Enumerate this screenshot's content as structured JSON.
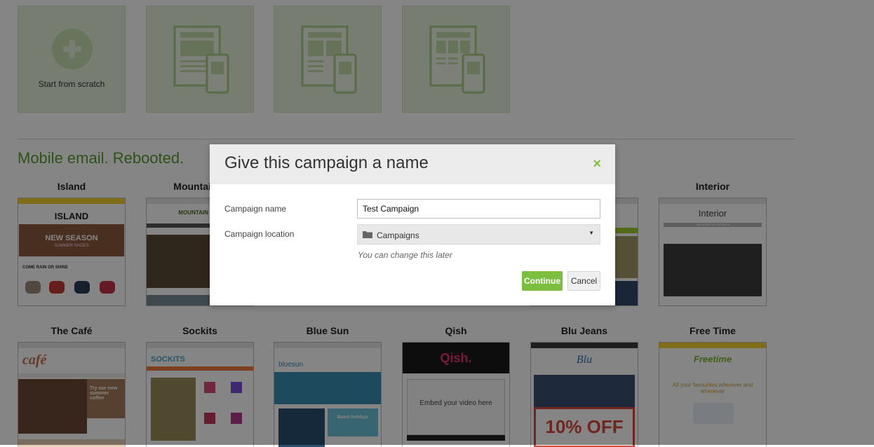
{
  "start_tiles": {
    "scratch_label": "Start from scratch"
  },
  "section": {
    "heading": "Mobile email. Rebooted."
  },
  "templates_row1": [
    {
      "title": "Island",
      "headline": "ISLAND",
      "banner": "NEW SEASON",
      "subbanner": "SUMMER SHOES",
      "tagline": "COME RAIN OR SHINE"
    },
    {
      "title": "Mountain E",
      "headline": "MOUNTAIN ESC"
    },
    {
      "title": "Interior",
      "headline": "Interior",
      "subbanner": "THE INSIDE OF INTERIOR"
    }
  ],
  "templates_row2": [
    {
      "title": "The Café",
      "headline": "café",
      "promo": "Try our new summer coffee"
    },
    {
      "title": "Sockits",
      "headline": "SOCKITS"
    },
    {
      "title": "Blue Sun",
      "headline": "bluesun",
      "promo": "Beach holidays"
    },
    {
      "title": "Qish",
      "headline": "Qish.",
      "promo": "Embed your video here"
    },
    {
      "title": "Blu Jeans",
      "headline": "Blu",
      "promo": "10% OFF"
    },
    {
      "title": "Free Time",
      "headline": "Freetime",
      "promo": "All your favourites wherever and whenever"
    }
  ],
  "modal": {
    "title": "Give this campaign a name",
    "close_label": "×",
    "name_label": "Campaign name",
    "name_value": "Test Campaign",
    "location_label": "Campaign location",
    "location_value": "Campaigns",
    "hint": "You can change this later",
    "continue_label": "Continue",
    "cancel_label": "Cancel"
  },
  "colors": {
    "accent_green": "#7cbf3f",
    "heading_green": "#5a9e2f",
    "tile_bg": "#e5f0d9"
  }
}
